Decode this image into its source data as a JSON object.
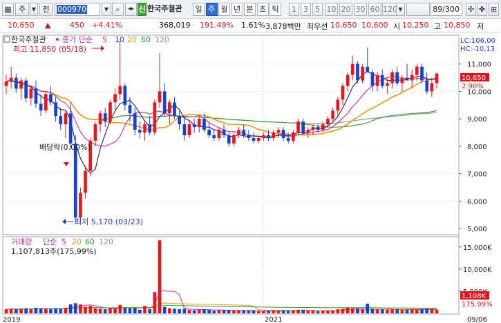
{
  "toolbar": {
    "market": "주",
    "exchange": "전",
    "code": "000970",
    "name_badge": "신",
    "stock_name": "한국주철관",
    "periods": [
      "일",
      "주",
      "월",
      "년",
      "분",
      "초",
      "틱"
    ],
    "active_period": "주",
    "intervals": [
      "1",
      "3",
      "5",
      "10",
      "20",
      "30",
      "60",
      "120"
    ],
    "counter": "89/300"
  },
  "pricebar": {
    "price": "10,650",
    "arrow": "▲",
    "change": "450",
    "change_pct": "+4.41%",
    "volume": "368,019",
    "vol_ratio": "191.49%",
    "turnover": "1.61%",
    "amount": "3,878백만",
    "best_ask_label": "최우선",
    "best_ask": "10,650",
    "best_bid": "10,600",
    "open_label": "시",
    "open": "10,250",
    "high_label": "고",
    "high": "10,850",
    "low_label": "저"
  },
  "price_panel": {
    "stock": "한국주철관",
    "ma_legend_label": "종가 단순",
    "ma_periods": [
      "5",
      "10",
      "20",
      "60",
      "120"
    ],
    "lc": "LC:106,00",
    "hc": "HC:-10,13",
    "high_note": "최고 11,850 (05/18)",
    "low_note": "최저 5,170 (03/23)",
    "dividend_note": "배당락(0.00%)",
    "last_price": "10,650",
    "last_pct": "2.90%",
    "y_ticks": [
      "11,000",
      "10,000",
      "9,000",
      "8,000",
      "7,000",
      "6,000",
      "5,000"
    ]
  },
  "volume_panel": {
    "label": "거래량",
    "ma_label": "단순",
    "ma_periods": [
      "5",
      "20",
      "60",
      "120"
    ],
    "current": "1,107,813주(175,99%)",
    "last_vol": "1,108K",
    "last_pct": "175.99%",
    "y_ticks": [
      "15,000K",
      "10,000K",
      "5,000K"
    ]
  },
  "x_axis": {
    "labels": [
      "2019",
      "2021",
      "09/06"
    ]
  },
  "colors": {
    "up": "#e8171e",
    "down": "#1743c9",
    "ma5": "#1b1b6e",
    "ma10": "#c42ca8",
    "ma20": "#e59a12",
    "ma60": "#2f9a2f",
    "ma120": "#8f8f8f"
  },
  "chart_data": {
    "type": "candlestick",
    "title": "한국주철관",
    "y_range": [
      4800,
      12000
    ],
    "price_scale_ticks": [
      5000,
      6000,
      7000,
      8000,
      9000,
      10000,
      11000
    ],
    "candles": [
      [
        10200,
        10600,
        9900,
        10350
      ],
      [
        10350,
        10900,
        10100,
        10500
      ],
      [
        10500,
        10650,
        9950,
        10100
      ],
      [
        10100,
        10500,
        9700,
        10400
      ],
      [
        10400,
        10500,
        9600,
        9750
      ],
      [
        9750,
        10200,
        9500,
        10100
      ],
      [
        10100,
        10400,
        9400,
        9550
      ],
      [
        9550,
        9900,
        9100,
        9300
      ],
      [
        9300,
        10000,
        9200,
        9900
      ],
      [
        9900,
        10200,
        9500,
        9600
      ],
      [
        9600,
        9800,
        8900,
        9100
      ],
      [
        9100,
        9400,
        8600,
        8800
      ],
      [
        8800,
        9300,
        8300,
        9200
      ],
      [
        9200,
        9600,
        7900,
        8100
      ],
      [
        8100,
        8400,
        5170,
        5400
      ],
      [
        5400,
        6500,
        5200,
        6300
      ],
      [
        6300,
        7300,
        6100,
        7100
      ],
      [
        7100,
        8300,
        6900,
        8200
      ],
      [
        8200,
        8900,
        8000,
        8800
      ],
      [
        8800,
        9300,
        8500,
        9200
      ],
      [
        9200,
        9400,
        8700,
        8900
      ],
      [
        8900,
        9700,
        8800,
        9600
      ],
      [
        9600,
        10100,
        9300,
        9900
      ],
      [
        9900,
        11850,
        9700,
        10200
      ],
      [
        10200,
        10300,
        9300,
        9500
      ],
      [
        9500,
        9800,
        8900,
        9200
      ],
      [
        9200,
        9400,
        8400,
        8600
      ],
      [
        8600,
        8900,
        8300,
        8500
      ],
      [
        8500,
        8900,
        8200,
        8800
      ],
      [
        8800,
        9100,
        8400,
        8500
      ],
      [
        8500,
        9700,
        8400,
        9600
      ],
      [
        9600,
        11400,
        9400,
        10000
      ],
      [
        10000,
        10300,
        9100,
        9200
      ],
      [
        9200,
        9700,
        8800,
        9600
      ],
      [
        9600,
        9800,
        9000,
        9100
      ],
      [
        9100,
        9300,
        8600,
        8800
      ],
      [
        8800,
        9000,
        8200,
        8400
      ],
      [
        8400,
        8900,
        8300,
        8800
      ],
      [
        8800,
        9000,
        8500,
        8700
      ],
      [
        8700,
        9100,
        8500,
        9000
      ],
      [
        9000,
        9200,
        8500,
        8600
      ],
      [
        8600,
        8900,
        8300,
        8400
      ],
      [
        8400,
        8600,
        8200,
        8300
      ],
      [
        8300,
        8700,
        8200,
        8600
      ],
      [
        8600,
        8800,
        8300,
        8400
      ],
      [
        8400,
        8500,
        8000,
        8100
      ],
      [
        8100,
        8500,
        8000,
        8400
      ],
      [
        8400,
        8700,
        8300,
        8600
      ],
      [
        8600,
        8800,
        8300,
        8400
      ],
      [
        8400,
        8600,
        8200,
        8300
      ],
      [
        8300,
        8500,
        8100,
        8200
      ],
      [
        8200,
        8400,
        8100,
        8300
      ],
      [
        8300,
        8500,
        8200,
        8400
      ],
      [
        8400,
        8600,
        8200,
        8300
      ],
      [
        8300,
        8600,
        8200,
        8500
      ],
      [
        8500,
        8700,
        8300,
        8600
      ],
      [
        8600,
        8700,
        8200,
        8300
      ],
      [
        8300,
        8500,
        8100,
        8200
      ],
      [
        8200,
        8600,
        8100,
        8500
      ],
      [
        8500,
        9000,
        8400,
        8900
      ],
      [
        8900,
        9000,
        8400,
        8500
      ],
      [
        8500,
        8700,
        8300,
        8600
      ],
      [
        8600,
        8800,
        8400,
        8700
      ],
      [
        8700,
        8800,
        8500,
        8600
      ],
      [
        8600,
        8900,
        8500,
        8800
      ],
      [
        8800,
        9100,
        8700,
        9000
      ],
      [
        9000,
        9400,
        8900,
        9300
      ],
      [
        9300,
        9800,
        9100,
        9700
      ],
      [
        9700,
        10300,
        9500,
        10200
      ],
      [
        10200,
        10700,
        10000,
        10600
      ],
      [
        10600,
        11300,
        10400,
        11000
      ],
      [
        11000,
        11100,
        10300,
        10400
      ],
      [
        10400,
        11000,
        10300,
        10900
      ],
      [
        10900,
        11600,
        10700,
        10700
      ],
      [
        10700,
        10800,
        10000,
        10200
      ],
      [
        10200,
        10700,
        10000,
        10600
      ],
      [
        10600,
        10800,
        10100,
        10200
      ],
      [
        10200,
        10500,
        9900,
        10300
      ],
      [
        10300,
        10800,
        10100,
        10700
      ],
      [
        10700,
        10900,
        10200,
        10300
      ],
      [
        10300,
        10600,
        10000,
        10500
      ],
      [
        10500,
        11000,
        10400,
        10400
      ],
      [
        10400,
        10800,
        10100,
        10600
      ],
      [
        10600,
        11000,
        10400,
        10900
      ],
      [
        10900,
        11000,
        10300,
        10400
      ],
      [
        10400,
        10700,
        9900,
        10000
      ],
      [
        10000,
        10500,
        9800,
        10300
      ],
      [
        10300,
        10700,
        10100,
        10650
      ]
    ],
    "volume_range": [
      0,
      17000
    ],
    "volume_scale_ticks": [
      5000,
      10000,
      15000
    ]
  }
}
